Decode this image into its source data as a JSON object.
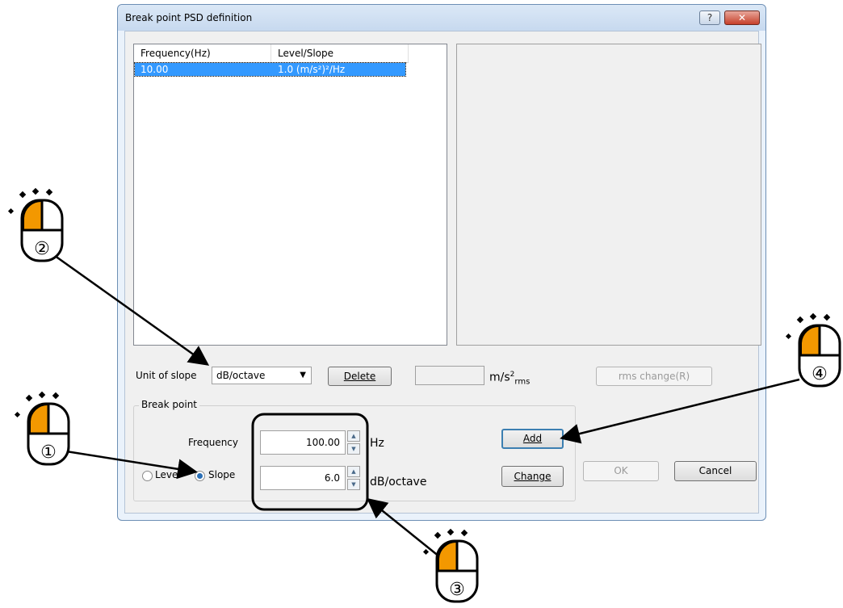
{
  "window": {
    "title": "Break point PSD definition",
    "help_glyph": "?",
    "close_glyph": "✕"
  },
  "list": {
    "columns": [
      "Frequency(Hz)",
      "Level/Slope"
    ],
    "rows": [
      {
        "frequency": "10.00",
        "level": "1.0 (m/s²)²/Hz"
      }
    ]
  },
  "controls": {
    "unit_of_slope_label": "Unit of slope",
    "unit_of_slope_value": "dB/octave",
    "delete_label": "Delete",
    "rms_unit_base": "m/s",
    "rms_unit_sup": "2",
    "rms_unit_sub": "rms",
    "rms_change_label": "rms change(R)"
  },
  "breakpoint": {
    "group_label": "Break point",
    "frequency_label": "Frequency",
    "frequency_value": "100.00",
    "frequency_unit": "Hz",
    "level_label": "Level",
    "slope_label": "Slope",
    "selected_mode": "Slope",
    "slope_value": "6.0",
    "slope_unit": "dB/octave"
  },
  "buttons": {
    "add_label": "Add",
    "change_label": "Change",
    "ok_label": "OK",
    "cancel_label": "Cancel"
  },
  "callouts": {
    "step1": "①",
    "step2": "②",
    "step3": "③",
    "step4": "④"
  },
  "colors": {
    "selection": "#3399ff",
    "mouse_button": "#f39800"
  }
}
